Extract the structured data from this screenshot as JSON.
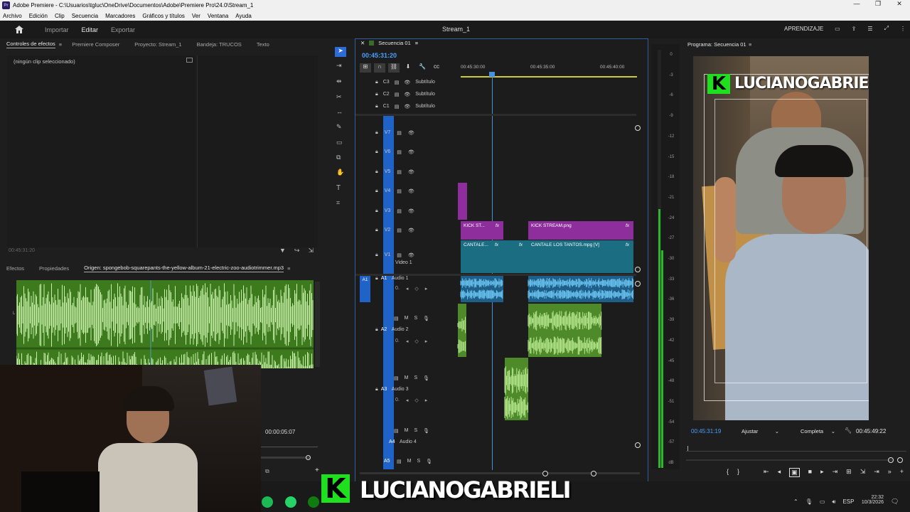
{
  "titlebar": {
    "title": "Adobe Premiere - C:\\Usuarios\\tgluc\\OneDrive\\Documentos\\Adobe\\Premiere Pro\\24.0\\Stream_1",
    "minimize": "—",
    "maximize": "❐",
    "close": "✕"
  },
  "menu": [
    "Archivo",
    "Edición",
    "Clip",
    "Secuencia",
    "Marcadores",
    "Gráficos y títulos",
    "Ver",
    "Ventana",
    "Ayuda"
  ],
  "appbar": {
    "import": "Importar",
    "edit": "Editar",
    "export": "Exportar",
    "project_title": "Stream_1",
    "learning": "APRENDIZAJE"
  },
  "effect_controls": {
    "tabs": [
      "Controles de efectos",
      "Premiere Composer",
      "Proyecto: Stream_1",
      "Bandeja: TRUCOS",
      "Texto"
    ],
    "no_clip": "(ningún clip seleccionado)",
    "timecode": "00:45:31:20"
  },
  "source": {
    "tabs": [
      "Efectos",
      "Propiedades",
      "Origen: spongebob-squarepants-the-yellow-album-21-electric-zoo-audiotrimmer.mp3"
    ],
    "timecode": "00:00:05:07",
    "channel_top": "L",
    "channel_bottom": "L"
  },
  "sequence": {
    "tab": "Secuencia 01",
    "timecode": "00:45:31:20",
    "ruler": [
      "00:45:30:00",
      "00:45:35:00",
      "00:45:40:00"
    ],
    "caption_tracks": [
      {
        "id": "C3",
        "label": "Subtítulo"
      },
      {
        "id": "C2",
        "label": "Subtítulo"
      },
      {
        "id": "C1",
        "label": "Subtítulo"
      }
    ],
    "video_tracks": [
      "V7",
      "V6",
      "V5",
      "V4",
      "V3",
      "V2",
      "V1"
    ],
    "v1_name": "Video 1",
    "audio_tracks": [
      {
        "id": "A1",
        "name": "Audio 1",
        "src": "A1"
      },
      {
        "id": "A2",
        "name": "Audio 2"
      },
      {
        "id": "A3",
        "name": "Audio 3"
      },
      {
        "id": "A4",
        "name": "Audio 4"
      },
      {
        "id": "A5",
        "name": ""
      }
    ],
    "clips": {
      "kick1": "KICK ST...",
      "kick2": "KICK STREAM.png",
      "cant1": "CANTALE...",
      "cant2": "CANTALE LOS TANTOS.mpg [V]",
      "fx": "fx"
    },
    "mute": "M",
    "solo": "S",
    "level": "0."
  },
  "vu_scale": [
    "0",
    "-3",
    "-6",
    "-9",
    "-12",
    "-15",
    "-18",
    "-21",
    "-24",
    "-27",
    "-30",
    "-33",
    "-36",
    "-39",
    "-42",
    "-45",
    "-48",
    "-51",
    "-54",
    "-57",
    "dB"
  ],
  "program": {
    "title": "Programa: Secuencia 01",
    "overlay_text": "LUCIANOGABRIELI",
    "logo_letter": "K",
    "timecode_left": "00:45:31:19",
    "fit": "Ajustar",
    "quality": "Completa",
    "timecode_right": "00:45:49:22"
  },
  "bottom_overlay": {
    "logo_letter": "K",
    "text": "LUCIANOGABRIELI"
  },
  "taskbar": {
    "lang": "ESP",
    "time": "22:32",
    "date": "10/3/2026"
  },
  "colors": {
    "accent": "#2d8ceb",
    "purple": "#8e2d9c",
    "teal": "#1b6e82",
    "audio_blue": "#3aa0d8",
    "audio_green": "#6bae3a",
    "kick_green": "#1ee01e"
  }
}
